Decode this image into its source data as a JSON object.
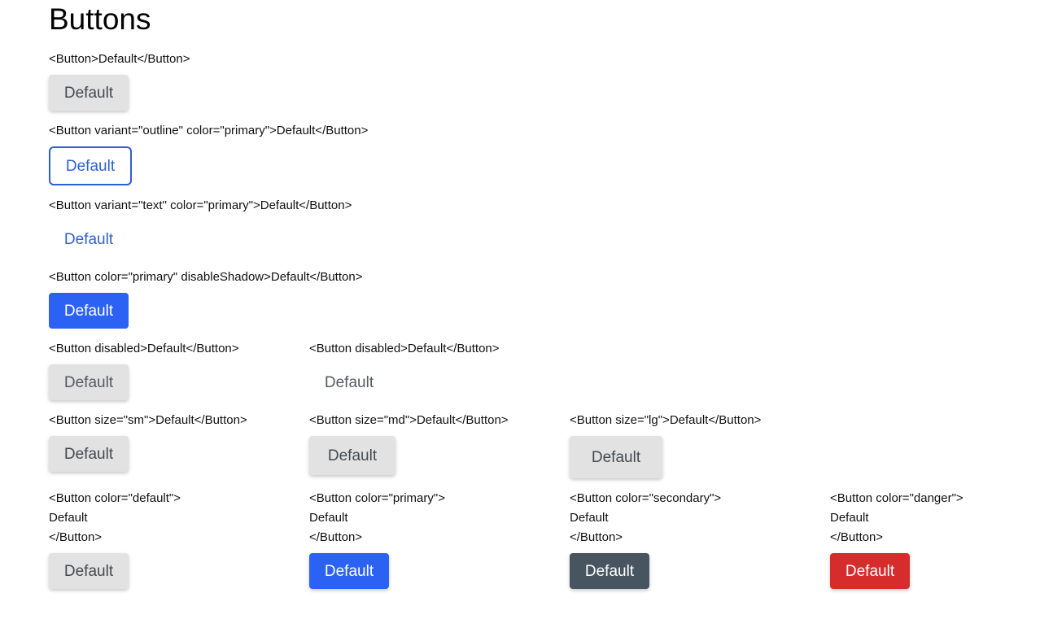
{
  "page": {
    "title": "Buttons"
  },
  "colors": {
    "primary": "#2b62f4",
    "outline_primary": "#2f5fd0",
    "default_bg": "#e2e2e2",
    "secondary": "#46555f",
    "danger": "#d62c2c"
  },
  "examples": {
    "basic": {
      "code": "<Button>Default</Button>",
      "button_label": "Default"
    },
    "outline": {
      "code": "<Button variant=\"outline\" color=\"primary\">Default</Button>",
      "button_label": "Default"
    },
    "text": {
      "code": "<Button variant=\"text\" color=\"primary\">Default</Button>",
      "button_label": "Default"
    },
    "disable_shadow": {
      "code": "<Button color=\"primary\" disableShadow>Default</Button>",
      "button_label": "Default"
    },
    "disabled_filled": {
      "code": "<Button disabled>Default</Button>",
      "button_label": "Default"
    },
    "disabled_text": {
      "code": "<Button disabled>Default</Button>",
      "button_label": "Default"
    },
    "size_sm": {
      "code": "<Button size=\"sm\">Default</Button>",
      "button_label": "Default"
    },
    "size_md": {
      "code": "<Button size=\"md\">Default</Button>",
      "button_label": "Default"
    },
    "size_lg": {
      "code": "<Button size=\"lg\">Default</Button>",
      "button_label": "Default"
    },
    "color_default": {
      "code_lines": [
        "<Button color=\"default\">",
        "Default",
        "</Button>"
      ],
      "button_label": "Default"
    },
    "color_primary": {
      "code_lines": [
        "<Button color=\"primary\">",
        "Default",
        "</Button>"
      ],
      "button_label": "Default"
    },
    "color_secondary": {
      "code_lines": [
        "<Button color=\"secondary\">",
        "Default",
        "</Button>"
      ],
      "button_label": "Default"
    },
    "color_danger": {
      "code_lines": [
        "<Button color=\"danger\">",
        "Default",
        "</Button>"
      ],
      "button_label": "Default"
    }
  }
}
